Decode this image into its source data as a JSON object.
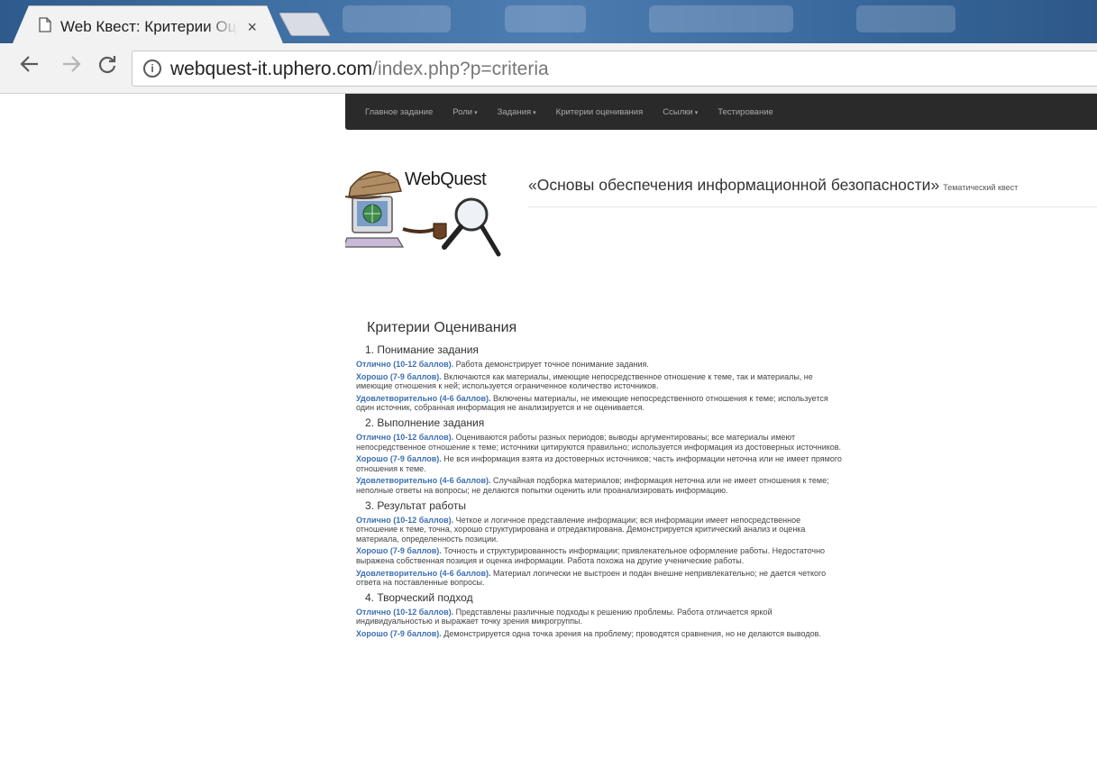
{
  "browser": {
    "tab_title": "Web Квест: Критерии Оценивания",
    "tab_close": "×",
    "url_host": "webquest-it.uphero.com",
    "url_path": "/index.php?p=criteria"
  },
  "navbar": {
    "items": [
      "Главное задание",
      "Роли",
      "Задания",
      "Критерии оценивания",
      "Ссылки",
      "Тестирование"
    ]
  },
  "header": {
    "logo_text": "WebQuest",
    "title": "«Основы обеспечения информационной безопасности»",
    "subtitle": "Тематический квест"
  },
  "content": {
    "heading": "Критерии Оценивания",
    "sections": [
      {
        "title": "1. Понимание задания",
        "levels": [
          {
            "label": "Отлично (10-12 баллов).",
            "text": " Работа демонстрирует точное понимание задания."
          },
          {
            "label": "Хорошо (7-9 баллов).",
            "text": " Включаются как материалы, имеющие непосредственное отношение к теме, так и материалы, не имеющие отношения к ней; используется ограниченное количество источников."
          },
          {
            "label": "Удовлетворительно (4-6 баллов).",
            "text": " Включены материалы, не имеющие непосредственного отношения к теме; используется один источник, собранная информация не анализируется и не оценивается."
          }
        ]
      },
      {
        "title": "2. Выполнение задания",
        "levels": [
          {
            "label": "Отлично (10-12 баллов).",
            "text": " Оцениваются работы разных периодов; выводы аргументированы; все материалы имеют непосредственное отношение к теме; источники цитируются правильно; используется информация из достоверных источников."
          },
          {
            "label": "Хорошо (7-9 баллов).",
            "text": " Не вся информация взята из достоверных источников; часть информации неточна или не имеет прямого отношения к теме."
          },
          {
            "label": "Удовлетворительно (4-6 баллов).",
            "text": " Случайная подборка материалов; информация неточна или не имеет отношения к теме; неполные ответы на вопросы; не делаются попытки оценить или проанализировать информацию."
          }
        ]
      },
      {
        "title": "3. Результат работы",
        "levels": [
          {
            "label": "Отлично (10-12 баллов).",
            "text": " Четкое и логичное представление информации; вся информации имеет непосредственное отношение к теме, точна, хорошо структурирована и отредактирована. Демонстрируется критический анализ и оценка материала, определенность позиции."
          },
          {
            "label": "Хорошо (7-9 баллов).",
            "text": " Точность и структурированность информации; привлекательное оформление работы. Недостаточно выражена собственная позиция и оценка информации. Работа похожа на другие ученические работы."
          },
          {
            "label": "Удовлетворительно (4-6 баллов).",
            "text": " Материал логически не выстроен и подан внешне непривлекательно; не дается четкого ответа на поставленные вопросы."
          }
        ]
      },
      {
        "title": "4. Творческий подход",
        "levels": [
          {
            "label": "Отлично (10-12 баллов).",
            "text": " Представлены различные подходы к решению проблемы. Работа отличается яркой индивидуальностью и выражает точку зрения микрогруппы."
          },
          {
            "label": "Хорошо (7-9 баллов).",
            "text": " Демонстрируется одна точка зрения на проблему; проводятся сравнения, но не делаются выводов."
          }
        ]
      }
    ]
  }
}
